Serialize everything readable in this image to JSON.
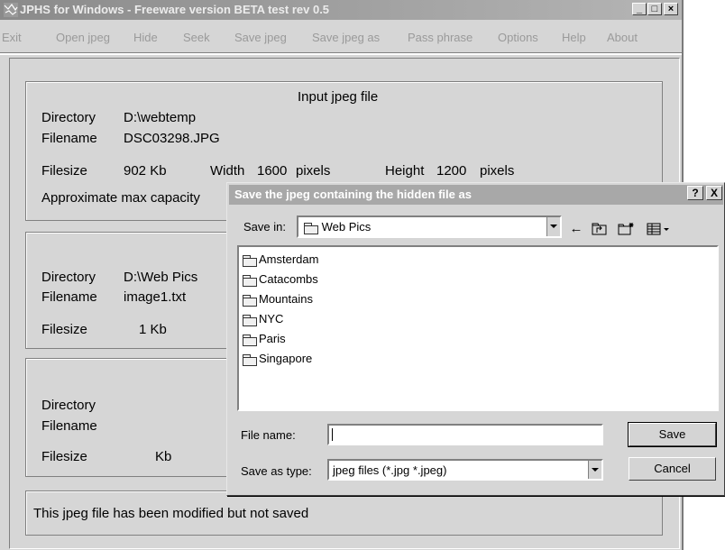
{
  "window": {
    "title": "JPHS for Windows - Freeware version BETA test rev 0.5"
  },
  "menu": [
    "Exit",
    "Open jpeg",
    "Hide",
    "Seek",
    "Save jpeg",
    "Save jpeg as",
    "Pass phrase",
    "Options",
    "Help",
    "About"
  ],
  "input_group": {
    "heading": "Input jpeg file",
    "directory_label": "Directory",
    "directory_value": "D:\\webtemp",
    "filename_label": "Filename",
    "filename_value": "DSC03298.JPG",
    "filesize_label": "Filesize",
    "filesize_value": "902 Kb",
    "width_label": "Width",
    "width_value": "1600",
    "width_unit": "pixels",
    "height_label": "Height",
    "height_value": "1200",
    "height_unit": "pixels",
    "capacity_label": "Approximate max capacity"
  },
  "hidden_group": {
    "directory_label": "Directory",
    "directory_value": "D:\\Web Pics",
    "filename_label": "Filename",
    "filename_value": "image1.txt",
    "filesize_label": "Filesize",
    "filesize_value": "1 Kb"
  },
  "output_group": {
    "directory_label": "Directory",
    "filename_label": "Filename",
    "filesize_label": "Filesize",
    "filesize_unit": "Kb"
  },
  "status": "This jpeg file has been modified but not saved",
  "dialog": {
    "title": "Save the jpeg containing the hidden file as",
    "help": "?",
    "close": "X",
    "save_in_label": "Save in:",
    "save_in_value": "Web Pics",
    "folders": [
      "Amsterdam",
      "Catacombs",
      "Mountains",
      "NYC",
      "Paris",
      "Singapore"
    ],
    "file_name_label": "File name:",
    "file_name_value": "",
    "save_as_type_label": "Save as type:",
    "save_as_type_value": "jpeg files (*.jpg *.jpeg)",
    "save_button": "Save",
    "cancel_button": "Cancel"
  }
}
